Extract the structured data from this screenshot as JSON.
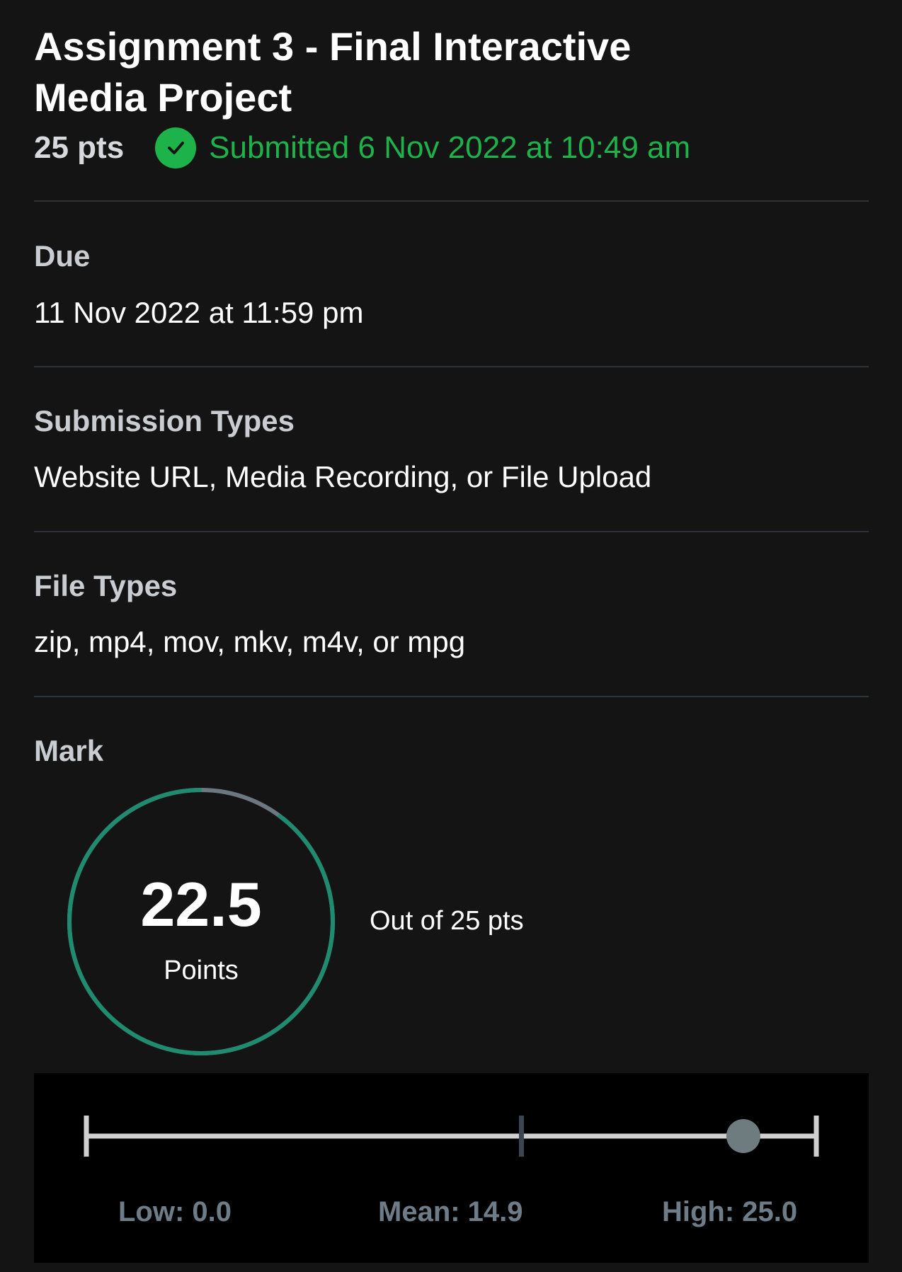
{
  "assignment": {
    "title": "Assignment 3 - Final Interactive Media Project",
    "points": "25 pts",
    "submission_status": "Submitted 6 Nov 2022 at 10:49 am"
  },
  "details": [
    {
      "label": "Due",
      "value": "11 Nov 2022 at 11:59 pm"
    },
    {
      "label": "Submission Types",
      "value": "Website URL, Media Recording, or File Upload"
    },
    {
      "label": "File Types",
      "value": "zip, mp4, mov, mkv, m4v, or mpg"
    }
  ],
  "mark": {
    "label": "Mark",
    "score": "22.5",
    "score_unit": "Points",
    "out_of": "Out of 25 pts",
    "score_value": 22.5,
    "max_value": 25
  },
  "stats": {
    "low_label": "Low: 0.0",
    "mean_label": "Mean: 14.9",
    "high_label": "High: 25.0",
    "low": 0.0,
    "mean": 14.9,
    "high": 25.0,
    "score": 22.5
  },
  "colors": {
    "success": "#1eb24a",
    "ring_progress": "#1f8c6f",
    "ring_track": "#6b7880",
    "range_line": "#d0d0d0",
    "mean_marker": "#3c4650",
    "score_marker": "#6e7c80"
  },
  "icons": {
    "submitted": "check-circle-icon"
  }
}
